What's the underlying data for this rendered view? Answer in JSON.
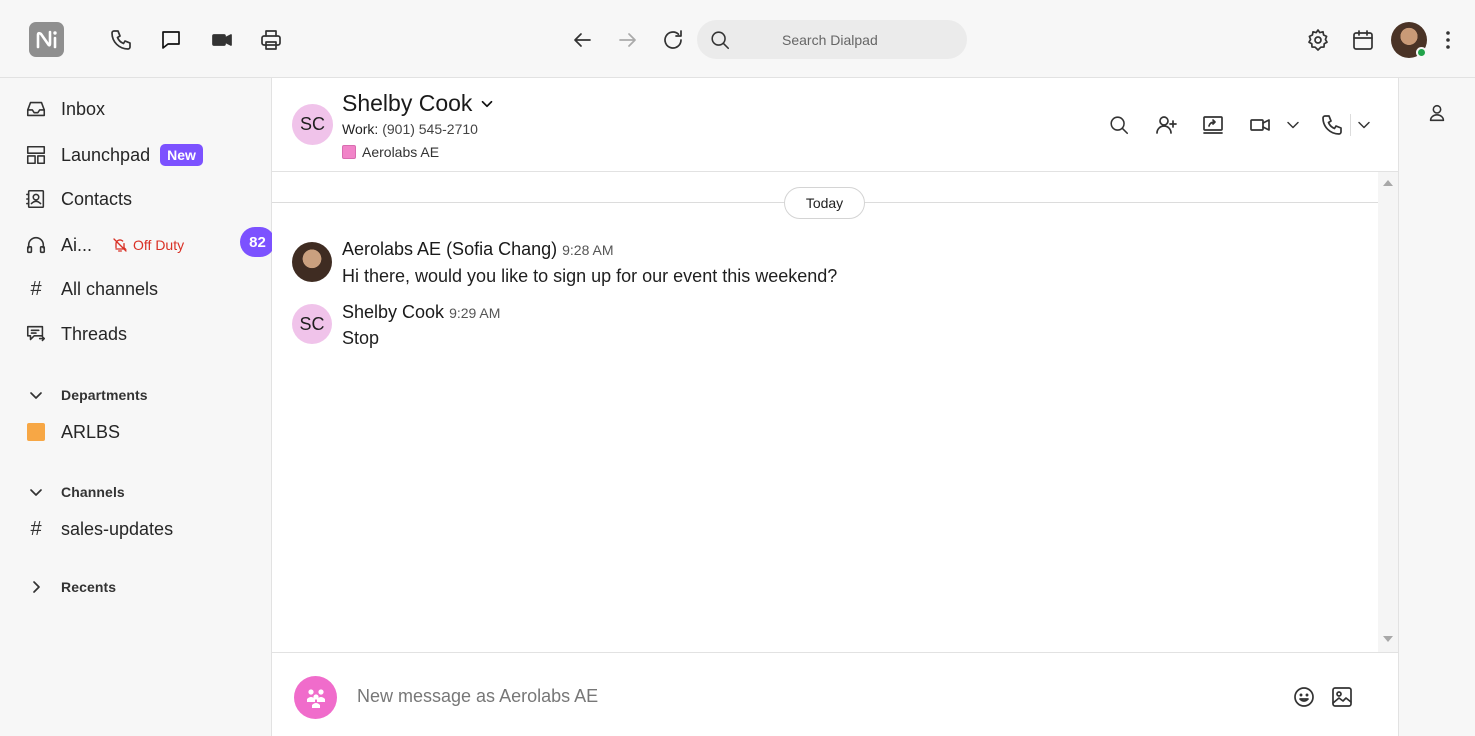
{
  "topbar": {
    "search_placeholder": "Search Dialpad",
    "icons": [
      "logo-icon",
      "phone-icon",
      "chat-icon",
      "video-icon",
      "print-icon",
      "back-icon",
      "forward-icon",
      "refresh-icon",
      "search-icon",
      "settings-icon",
      "calendar-icon",
      "more-icon"
    ]
  },
  "sidebar": {
    "inbox": "Inbox",
    "launchpad": "Launchpad",
    "launchpad_badge": "New",
    "contacts": "Contacts",
    "ai": "Ai...",
    "off_duty": "Off Duty",
    "ai_count": "82",
    "all_channels": "All channels",
    "threads": "Threads",
    "departments_header": "Departments",
    "department_item": "ARLBS",
    "channels_header": "Channels",
    "channel_item": "sales-updates",
    "recents_header": "Recents"
  },
  "conversation": {
    "initials": "SC",
    "name": "Shelby Cook",
    "work_label": "Work:",
    "work_number": "(901) 545-2710",
    "department": "Aerolabs AE"
  },
  "messages": {
    "day": "Today",
    "items": [
      {
        "sender": "Aerolabs AE (Sofia Chang)",
        "time": "9:28 AM",
        "text": "Hi there, would you like to sign up for our event this weekend?"
      },
      {
        "sender": "Shelby Cook",
        "initials": "SC",
        "time": "9:29 AM",
        "text": "Stop"
      }
    ]
  },
  "composer": {
    "placeholder": "New message as Aerolabs AE"
  },
  "colors": {
    "accent_purple": "#7c52ff",
    "avatar_pink": "#f0c3ea",
    "department_orange": "#f7a745",
    "off_duty_red": "#d93025",
    "presence_green": "#21a34a"
  }
}
